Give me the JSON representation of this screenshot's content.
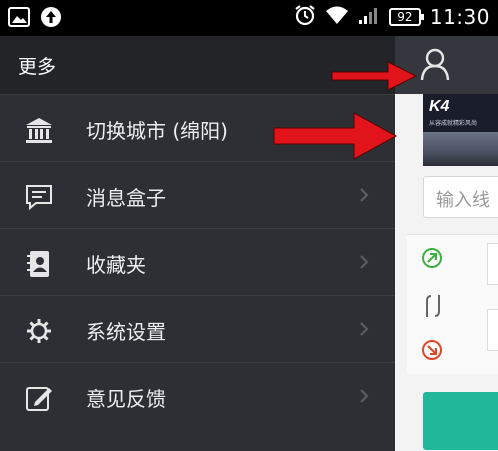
{
  "status_bar": {
    "time": "11:30",
    "battery": "92",
    "icons": [
      "image-icon",
      "upload-icon",
      "alarm-icon",
      "wifi-icon",
      "signal-icon",
      "battery-icon"
    ]
  },
  "drawer": {
    "title": "更多",
    "items": [
      {
        "label": "切换城市 (绵阳)",
        "icon": "bank-icon",
        "chevron": false
      },
      {
        "label": "消息盒子",
        "icon": "message-icon",
        "chevron": true
      },
      {
        "label": "收藏夹",
        "icon": "contacts-book-icon",
        "chevron": true
      },
      {
        "label": "系统设置",
        "icon": "gear-icon",
        "chevron": true
      },
      {
        "label": "意见反馈",
        "icon": "edit-icon",
        "chevron": true
      }
    ]
  },
  "app": {
    "user_icon": "user-icon",
    "banner": {
      "brand": "K4",
      "subtitle": "从容成就精彩风尚"
    },
    "search_placeholder": "输入线"
  },
  "colors": {
    "drawer_bg": "#2d2f34",
    "accent_green": "#1fb89a",
    "arrow_red": "#e0141a"
  }
}
